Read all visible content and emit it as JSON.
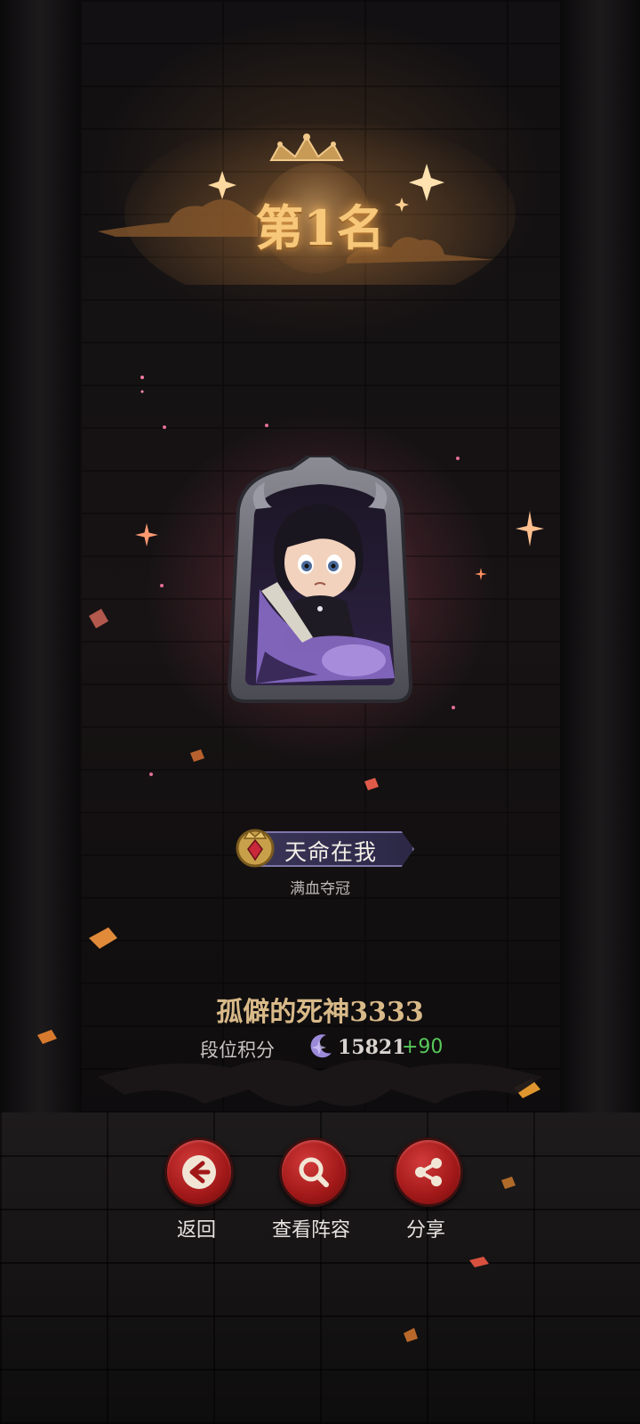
{
  "rank": {
    "title": "第1名"
  },
  "achievement": {
    "title": "天命在我",
    "subtitle": "满血夺冠"
  },
  "player": {
    "name": "孤僻的死神3333",
    "score_label": "段位积分",
    "score_value": "15821",
    "score_delta": "+90"
  },
  "actions": [
    {
      "label": "返回",
      "icon": "arrow-left-icon"
    },
    {
      "label": "查看阵容",
      "icon": "magnifier-icon"
    },
    {
      "label": "分享",
      "icon": "share-icon"
    }
  ],
  "colors": {
    "title_gold": "#f7c77a",
    "name_gold": "#d8b988",
    "delta_green": "#57c85a",
    "button_red": "#a11818",
    "badge_purple": "#3a3558"
  }
}
